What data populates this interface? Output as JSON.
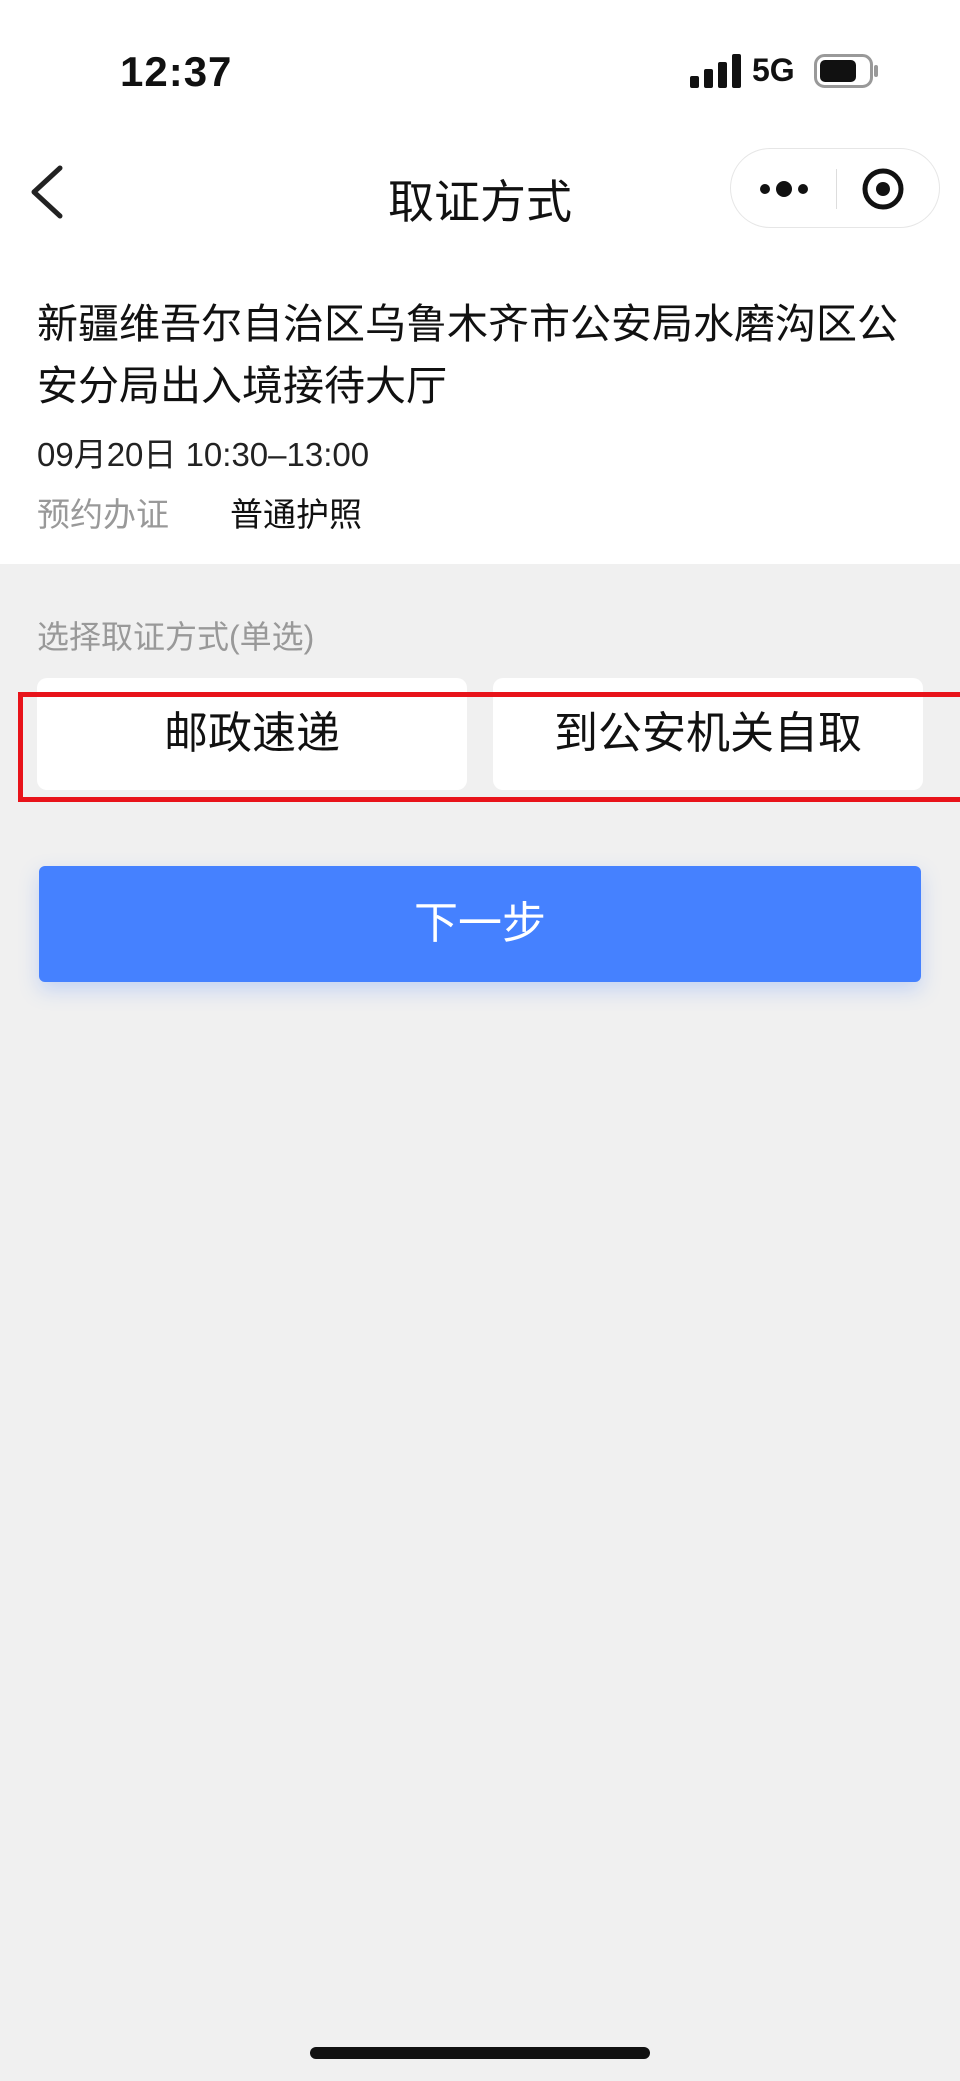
{
  "status_bar": {
    "time": "12:37",
    "network": "5G"
  },
  "nav": {
    "title": "取证方式"
  },
  "appointment": {
    "office": "新疆维吾尔自治区乌鲁木齐市公安局水磨沟区公安分局出入境接待大厅",
    "datetime": "09月20日 10:30–13:00",
    "business_label": "预约办证",
    "business_value": "普通护照"
  },
  "pickup": {
    "section_label": "选择取证方式(单选)",
    "options": [
      "邮政速递",
      "到公安机关自取"
    ]
  },
  "next_button": {
    "label": "下一步"
  },
  "colors": {
    "accent": "#4581ff",
    "highlight": "#e8131a"
  }
}
